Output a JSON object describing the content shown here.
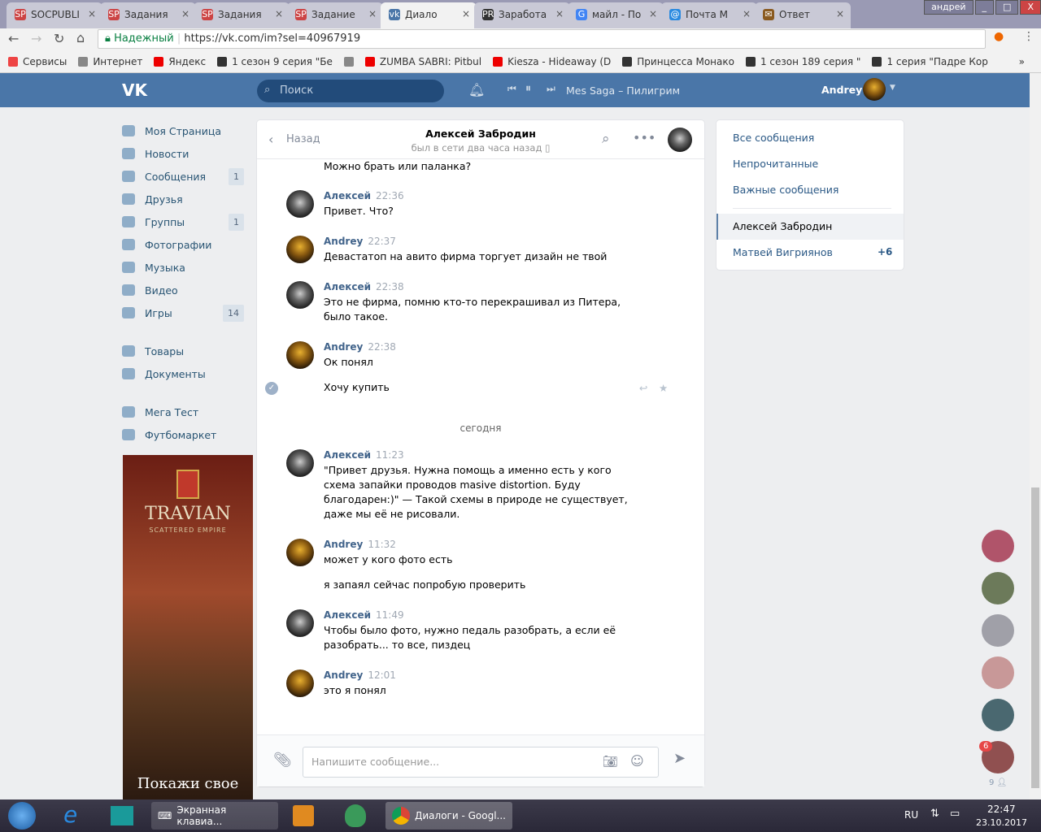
{
  "browser": {
    "tabs": [
      {
        "icon": "SP",
        "label": "SOCPUBLI"
      },
      {
        "icon": "SP",
        "label": "Задания"
      },
      {
        "icon": "SP",
        "label": "Задания"
      },
      {
        "icon": "SP",
        "label": "Задание"
      },
      {
        "icon": "vk",
        "label": "Диало",
        "active": true
      },
      {
        "icon": "PR",
        "label": "Заработа"
      },
      {
        "icon": "G",
        "label": "майл - По"
      },
      {
        "icon": "@",
        "label": "Почта М"
      },
      {
        "icon": "✉",
        "label": "Ответ"
      }
    ],
    "user": "андрей",
    "secure_label": "Надежный",
    "url": "https://vk.com/im?sel=40967919",
    "bookmarks": [
      "Сервисы",
      "Интернет",
      "Яндекс",
      "1 сезон 9 серия \"Бе",
      "",
      "ZUMBA SABRI: Pitbul",
      "Kiesza - Hideaway (D",
      "Принцесса Монако",
      "1 сезон 189 серия \"",
      "1 серия \"Падре Кор"
    ],
    "more": "»"
  },
  "vk": {
    "search_placeholder": "Поиск",
    "player": "Mes Saga – Пилигрим",
    "username": "Andrey",
    "nav": [
      {
        "label": "Моя Страница"
      },
      {
        "label": "Новости"
      },
      {
        "label": "Сообщения",
        "count": "1"
      },
      {
        "label": "Друзья"
      },
      {
        "label": "Группы",
        "count": "1"
      },
      {
        "label": "Фотографии"
      },
      {
        "label": "Музыка"
      },
      {
        "label": "Видео"
      },
      {
        "label": "Игры",
        "count": "14"
      }
    ],
    "nav2": [
      {
        "label": "Товары"
      },
      {
        "label": "Документы"
      }
    ],
    "nav3": [
      {
        "label": "Мега Тест"
      },
      {
        "label": "Футбомаркет"
      }
    ],
    "ad": {
      "title": "TRAVIAN",
      "subtitle": "SCATTERED EMPIRE",
      "cta": "Покажи свое"
    },
    "dialog": {
      "back": "Назад",
      "name": "Алексей Забродин",
      "status": "был в сети два часа назад",
      "top_text": "Можно брать или паланка?",
      "date_sep": "сегодня",
      "messages": [
        {
          "who": "a",
          "name": "Алексей",
          "time": "22:36",
          "lines": [
            "Привет. Что?"
          ]
        },
        {
          "who": "b",
          "name": "Andrey",
          "time": "22:37",
          "lines": [
            "Девастатоп на авито фирма торгует дизайн не твой"
          ]
        },
        {
          "who": "a",
          "name": "Алексей",
          "time": "22:38",
          "lines": [
            "Это не фирма, помню кто-то перекрашивал из Питера, было такое."
          ]
        },
        {
          "who": "b",
          "name": "Andrey",
          "time": "22:38",
          "lines": [
            "Ок понял"
          ],
          "extra": "Хочу купить"
        },
        {
          "who": "a",
          "name": "Алексей",
          "time": "11:23",
          "lines": [
            "\"Привет друзья. Нужна помощь а именно есть у кого схема запайки проводов masive distortion. Буду благодарен:)\" — Такой схемы в природе не существует, даже мы её не рисовали."
          ]
        },
        {
          "who": "b",
          "name": "Andrey",
          "time": "11:32",
          "lines": [
            "может у кого фото есть"
          ],
          "extra": "я запаял сейчас попробую проверить"
        },
        {
          "who": "a",
          "name": "Алексей",
          "time": "11:49",
          "lines": [
            "Чтобы было фото, нужно педаль разобрать, а если её разобрать... то все, пиздец"
          ]
        },
        {
          "who": "b",
          "name": "Andrey",
          "time": "12:01",
          "lines": [
            "это я понял"
          ]
        }
      ],
      "input_placeholder": "Напишите сообщение..."
    },
    "right": {
      "all": "Все сообщения",
      "unread": "Непрочитанные",
      "important": "Важные сообщения",
      "chats": [
        {
          "name": "Алексей Забродин"
        },
        {
          "name": "Матвей Вигриянов",
          "count": "+6"
        }
      ]
    },
    "friends_badge": "6",
    "online_count": "9"
  },
  "taskbar": {
    "items": [
      "Экранная клавиа...",
      "Диалоги - Googl..."
    ],
    "lang": "RU",
    "time": "22:47",
    "date": "23.10.2017"
  }
}
